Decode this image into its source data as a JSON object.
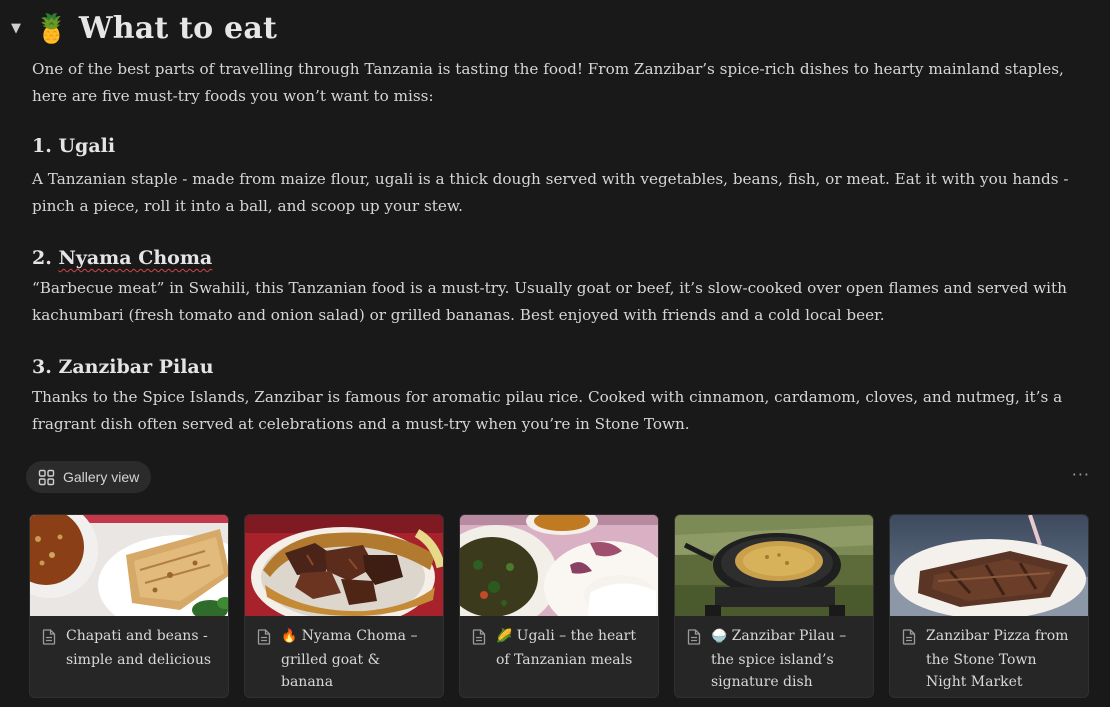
{
  "toggle": {
    "arrow": "▼",
    "emoji": "🍍",
    "title": "What to eat"
  },
  "intro": "One of the best parts of travelling through Tanzania is tasting the food! From Zanzibar’s spice-rich dishes to hearty mainland staples, here are five must-try foods you won’t want to miss:",
  "sections": [
    {
      "number": "1.",
      "name": "Ugali",
      "text": "A Tanzanian staple - made from maize flour, ugali is a thick dough served with vegetables, beans, fish, or meat. Eat it with you hands - pinch a piece, roll it into a ball, and scoop up your stew."
    },
    {
      "number": "2.",
      "name": "Nyama Choma",
      "text": "“Barbecue meat” in Swahili, this Tanzanian food is a must-try. Usually goat or beef, it’s slow-cooked over open flames and served with kachumbari (fresh tomato and onion salad) or grilled bananas. Best enjoyed with friends and a cold local beer."
    },
    {
      "number": "3.",
      "name": "Zanzibar Pilau",
      "text": "Thanks to the Spice Islands, Zanzibar is famous for aromatic pilau rice. Cooked with cinnamon, cardamom, cloves, and nutmeg, it’s a fragrant dish often served at celebrations and a must-try when you’re in Stone Town."
    }
  ],
  "gallery": {
    "view_label": "Gallery view",
    "more_label": "···",
    "cards": [
      {
        "emoji": "",
        "title": "Chapati and beans - simple and delicious"
      },
      {
        "emoji": "🔥",
        "title": "Nyama Choma – grilled goat & banana"
      },
      {
        "emoji": "🌽",
        "title": "Ugali – the heart of Tanzanian meals"
      },
      {
        "emoji": "🍚",
        "title": "Zanzibar Pilau – the spice island’s signature dish"
      },
      {
        "emoji": "",
        "title": "Zanzibar Pizza from the Stone Town Night Market"
      }
    ]
  },
  "colors": {
    "background": "#191919",
    "card_background": "#262626",
    "text": "#d4d4d4",
    "spellcheck_underline": "#d24545"
  }
}
